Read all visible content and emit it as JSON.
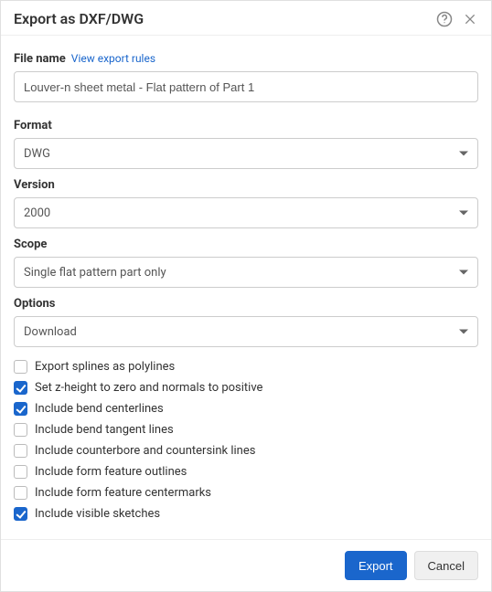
{
  "header": {
    "title": "Export as DXF/DWG"
  },
  "file": {
    "label": "File name",
    "rules_link": "View export rules",
    "value": "Louver-n sheet metal - Flat pattern of Part 1"
  },
  "format": {
    "label": "Format",
    "value": "DWG"
  },
  "version": {
    "label": "Version",
    "value": "2000"
  },
  "scope": {
    "label": "Scope",
    "value": "Single flat pattern part only"
  },
  "options": {
    "label": "Options",
    "value": "Download"
  },
  "checkboxes": [
    {
      "label": "Export splines as polylines",
      "checked": false
    },
    {
      "label": "Set z-height to zero and normals to positive",
      "checked": true
    },
    {
      "label": "Include bend centerlines",
      "checked": true
    },
    {
      "label": "Include bend tangent lines",
      "checked": false
    },
    {
      "label": "Include counterbore and countersink lines",
      "checked": false
    },
    {
      "label": "Include form feature outlines",
      "checked": false
    },
    {
      "label": "Include form feature centermarks",
      "checked": false
    },
    {
      "label": "Include visible sketches",
      "checked": true
    }
  ],
  "footer": {
    "export": "Export",
    "cancel": "Cancel"
  }
}
